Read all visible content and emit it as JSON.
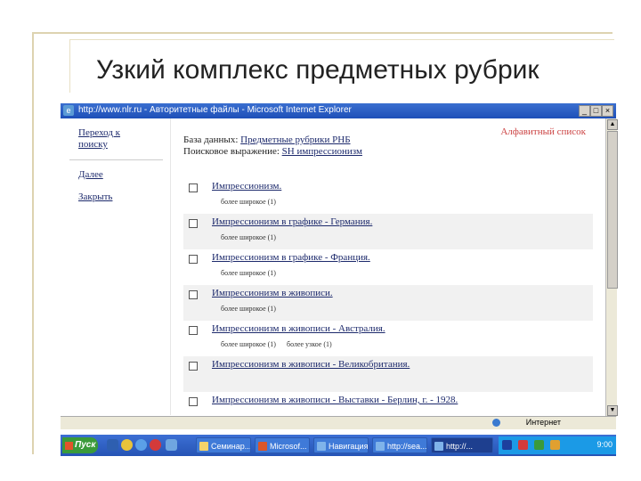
{
  "slide": {
    "title": "Узкий комплекс предметных рубрик"
  },
  "window": {
    "title": "http://www.nlr.ru - Авторитетные файлы - Microsoft Internet Explorer",
    "minimize": "_",
    "maximize": "□",
    "close": "×"
  },
  "sidebar": {
    "items": [
      {
        "label_line1": "Переход к",
        "label_line2": "поиску"
      },
      {
        "label": "Далее"
      },
      {
        "label": "Закрыть"
      }
    ]
  },
  "content": {
    "db_label": "База данных:",
    "db_value": "Предметные рубрики РНБ",
    "query_label": "Поисковое выражение:",
    "query_value": "SH импрессионизм",
    "alpha_link": "Алфавитный список"
  },
  "results": [
    {
      "title": "Импрессионизм.",
      "broader": "более широкое (1)",
      "narrower": ""
    },
    {
      "title": "Импрессионизм в графике - Германия.",
      "broader": "более широкое (1)",
      "narrower": ""
    },
    {
      "title": "Импрессионизм в графике - Франция.",
      "broader": "более широкое (1)",
      "narrower": ""
    },
    {
      "title": "Импрессионизм в живописи.",
      "broader": "более широкое (1)",
      "narrower": ""
    },
    {
      "title": "Импрессионизм в живописи - Австралия.",
      "broader": "более широкое (1)",
      "narrower": "более узкое (1)"
    },
    {
      "title": "Импрессионизм в живописи - Великобритания.",
      "broader": "",
      "narrower": ""
    },
    {
      "title": "Импрессионизм в живописи - Выставки - Берлин, г. - 1928.",
      "broader": "",
      "narrower": ""
    }
  ],
  "statusbar": {
    "zone": "Интернет"
  },
  "taskbar": {
    "start": "Пуск",
    "tasks": [
      {
        "label": "Семинар..."
      },
      {
        "label": "Microsof..."
      },
      {
        "label": "Навигация..."
      },
      {
        "label": "http://sea..."
      },
      {
        "label": "http://..."
      }
    ],
    "clock": "9:00"
  },
  "colors": {
    "link": "#1d2a6c",
    "alpha_link": "#cc4444",
    "titlebar": "#2a5cc4",
    "taskbar": "#2f62c6"
  }
}
